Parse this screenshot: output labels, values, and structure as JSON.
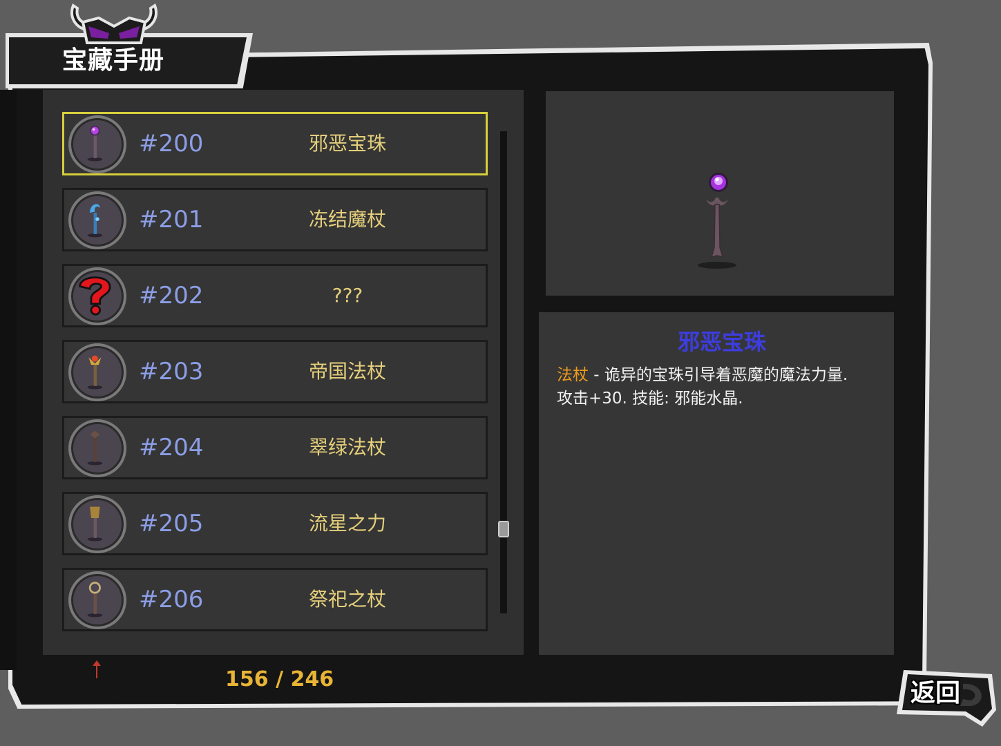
{
  "title": "宝藏手册",
  "list": {
    "items": [
      {
        "number": "#200",
        "name": "邪恶宝珠",
        "icon": "purple-orb-staff-icon",
        "selected": true
      },
      {
        "number": "#201",
        "name": "冻结魔杖",
        "icon": "ice-staff-icon",
        "selected": false
      },
      {
        "number": "#202",
        "name": "???",
        "icon": "question-mark-icon",
        "selected": false
      },
      {
        "number": "#203",
        "name": "帝国法杖",
        "icon": "imperial-staff-icon",
        "selected": false
      },
      {
        "number": "#204",
        "name": "翠绿法杖",
        "icon": "emerald-staff-icon",
        "selected": false
      },
      {
        "number": "#205",
        "name": "流星之力",
        "icon": "meteor-staff-icon",
        "selected": false
      },
      {
        "number": "#206",
        "name": "祭祀之杖",
        "icon": "ritual-staff-icon",
        "selected": false
      }
    ]
  },
  "progress": "156 / 246",
  "detail": {
    "title": "邪恶宝珠",
    "category": "法杖",
    "line1": " - 诡异的宝珠引导着恶魔的魔法力量.",
    "line2": "攻击+30. 技能: 邪能水晶."
  },
  "back_label": "返回",
  "colors": {
    "selected_border": "#d7cf3c",
    "number_text": "#8c9ee6",
    "name_text": "#e5cf7b",
    "item_title": "#3d3de0",
    "category_text": "#ee9b1c",
    "progress_text": "#e8b436"
  }
}
